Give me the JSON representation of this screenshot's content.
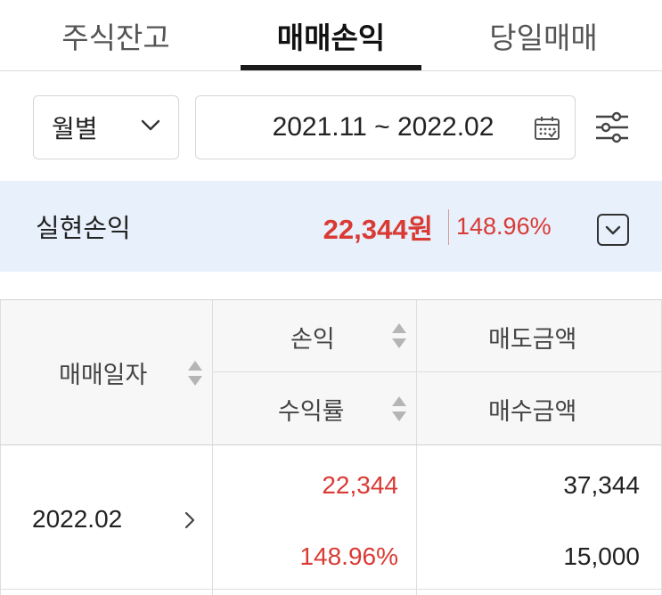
{
  "tabs": [
    {
      "label": "주식잔고"
    },
    {
      "label": "매매손익"
    },
    {
      "label": "당일매매"
    }
  ],
  "filters": {
    "period_label": "월별",
    "date_range": "2021.11 ~ 2022.02"
  },
  "summary": {
    "label": "실현손익",
    "amount": "22,344원",
    "rate": "148.96%"
  },
  "table": {
    "headers": {
      "date": "매매일자",
      "profit": "손익",
      "return_rate": "수익률",
      "sell_amount": "매도금액",
      "buy_amount": "매수금액"
    },
    "rows": [
      {
        "date": "2022.02",
        "profit": "22,344",
        "return_rate": "148.96%",
        "sell_amount": "37,344",
        "buy_amount": "15,000"
      }
    ]
  },
  "colors": {
    "accent_red": "#d93a34",
    "summary_bg": "#e7f0fb",
    "active_tab": "#1a1a1a"
  }
}
